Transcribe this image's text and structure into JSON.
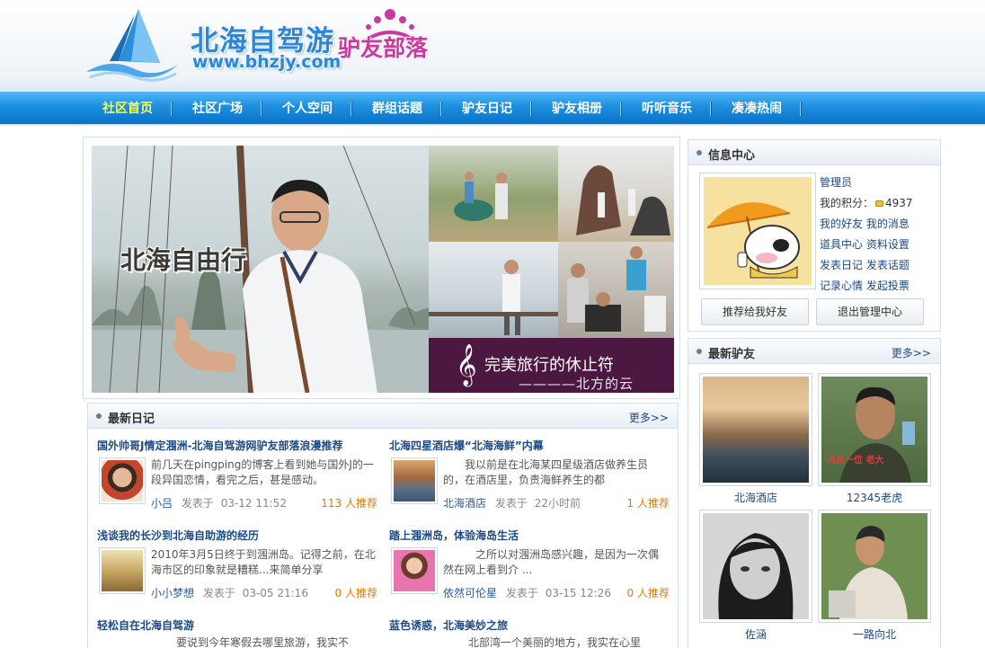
{
  "header": {
    "logo_cn": "北海自驾游",
    "logo_url": "www.bhzjy.com",
    "logo_tag": "驴友部落"
  },
  "nav": {
    "items": [
      "社区首页",
      "社区广场",
      "个人空间",
      "群组话题",
      "驴友日记",
      "驴友相册",
      "听听音乐",
      "凑凑热闹"
    ]
  },
  "banner": {
    "title": "北海自由行",
    "caption1": "完美旅行的休止符",
    "caption2": "————北方的云"
  },
  "diaries": {
    "title": "最新日记",
    "more": "更多>>",
    "items": [
      {
        "title": "国外帅哥J情定涠洲-北海自驾游网驴友部落浪漫推荐",
        "text": "前几天在pingping的博客上看到她与国外J的一段异国恋情，看完之后，甚是感动。",
        "author": "小吕",
        "posted": "发表于",
        "date": "03-12 11:52",
        "count": "113",
        "recommend": "人推荐"
      },
      {
        "title": "北海四星酒店爆“北海海鲜”内幕",
        "text": "我以前是在北海某四星级酒店做养生员的，在酒店里，负责海鲜养生的都",
        "author": "北海酒店",
        "posted": "发表于",
        "date": "22小时前",
        "count": "1",
        "recommend": "人推荐"
      },
      {
        "title": "浅谈我的长沙到北海自助游的经历",
        "text": "2010年3月5日终于到涠洲岛。记得之前，在北海市区的印象就是糟糕...来简单分享",
        "author": "小小梦想",
        "posted": "发表于",
        "date": "03-05 21:16",
        "count": "0",
        "recommend": "人推荐"
      },
      {
        "title": "踏上涠洲岛，体验海岛生活",
        "text": "之所以对涠洲岛感兴趣，是因为一次偶然在网上看到介 ...",
        "author": "依然可伦星",
        "posted": "发表于",
        "date": "03-15 12:26",
        "count": "0",
        "recommend": "人推荐"
      },
      {
        "title": "轻松自在北海自驾游",
        "text": "要说到今年寒假去哪里旅游，我实不",
        "author": "",
        "posted": "",
        "date": "",
        "count": "",
        "recommend": ""
      },
      {
        "title": "蓝色诱惑，北海美妙之旅",
        "text": "北部湾一个美丽的地方，我实在心里",
        "author": "",
        "posted": "",
        "date": "",
        "count": "",
        "recommend": ""
      }
    ]
  },
  "info": {
    "title": "信息中心",
    "role": "管理员",
    "points_label": "我的积分：",
    "points": "4937",
    "links": [
      [
        "我的好友",
        "我的消息"
      ],
      [
        "道具中心",
        "资料设置"
      ],
      [
        "发表日记",
        "发表话题"
      ],
      [
        "记录心情",
        "发起投票"
      ]
    ],
    "btn_recommend": "推荐给我好友",
    "btn_exit": "退出管理中心"
  },
  "friends": {
    "title": "最新驴友",
    "more": "更多>>",
    "items": [
      {
        "name": "北海酒店"
      },
      {
        "name": "12345老虎"
      },
      {
        "name": "佐涵"
      },
      {
        "name": "一路向北"
      }
    ],
    "photo_text_2": "两百一位 老大"
  },
  "colors": {
    "nav_blue": "#1e8fe0",
    "nav_active": "#f6ff52",
    "link_blue": "#1c4a86",
    "count_orange": "#e07b00"
  }
}
